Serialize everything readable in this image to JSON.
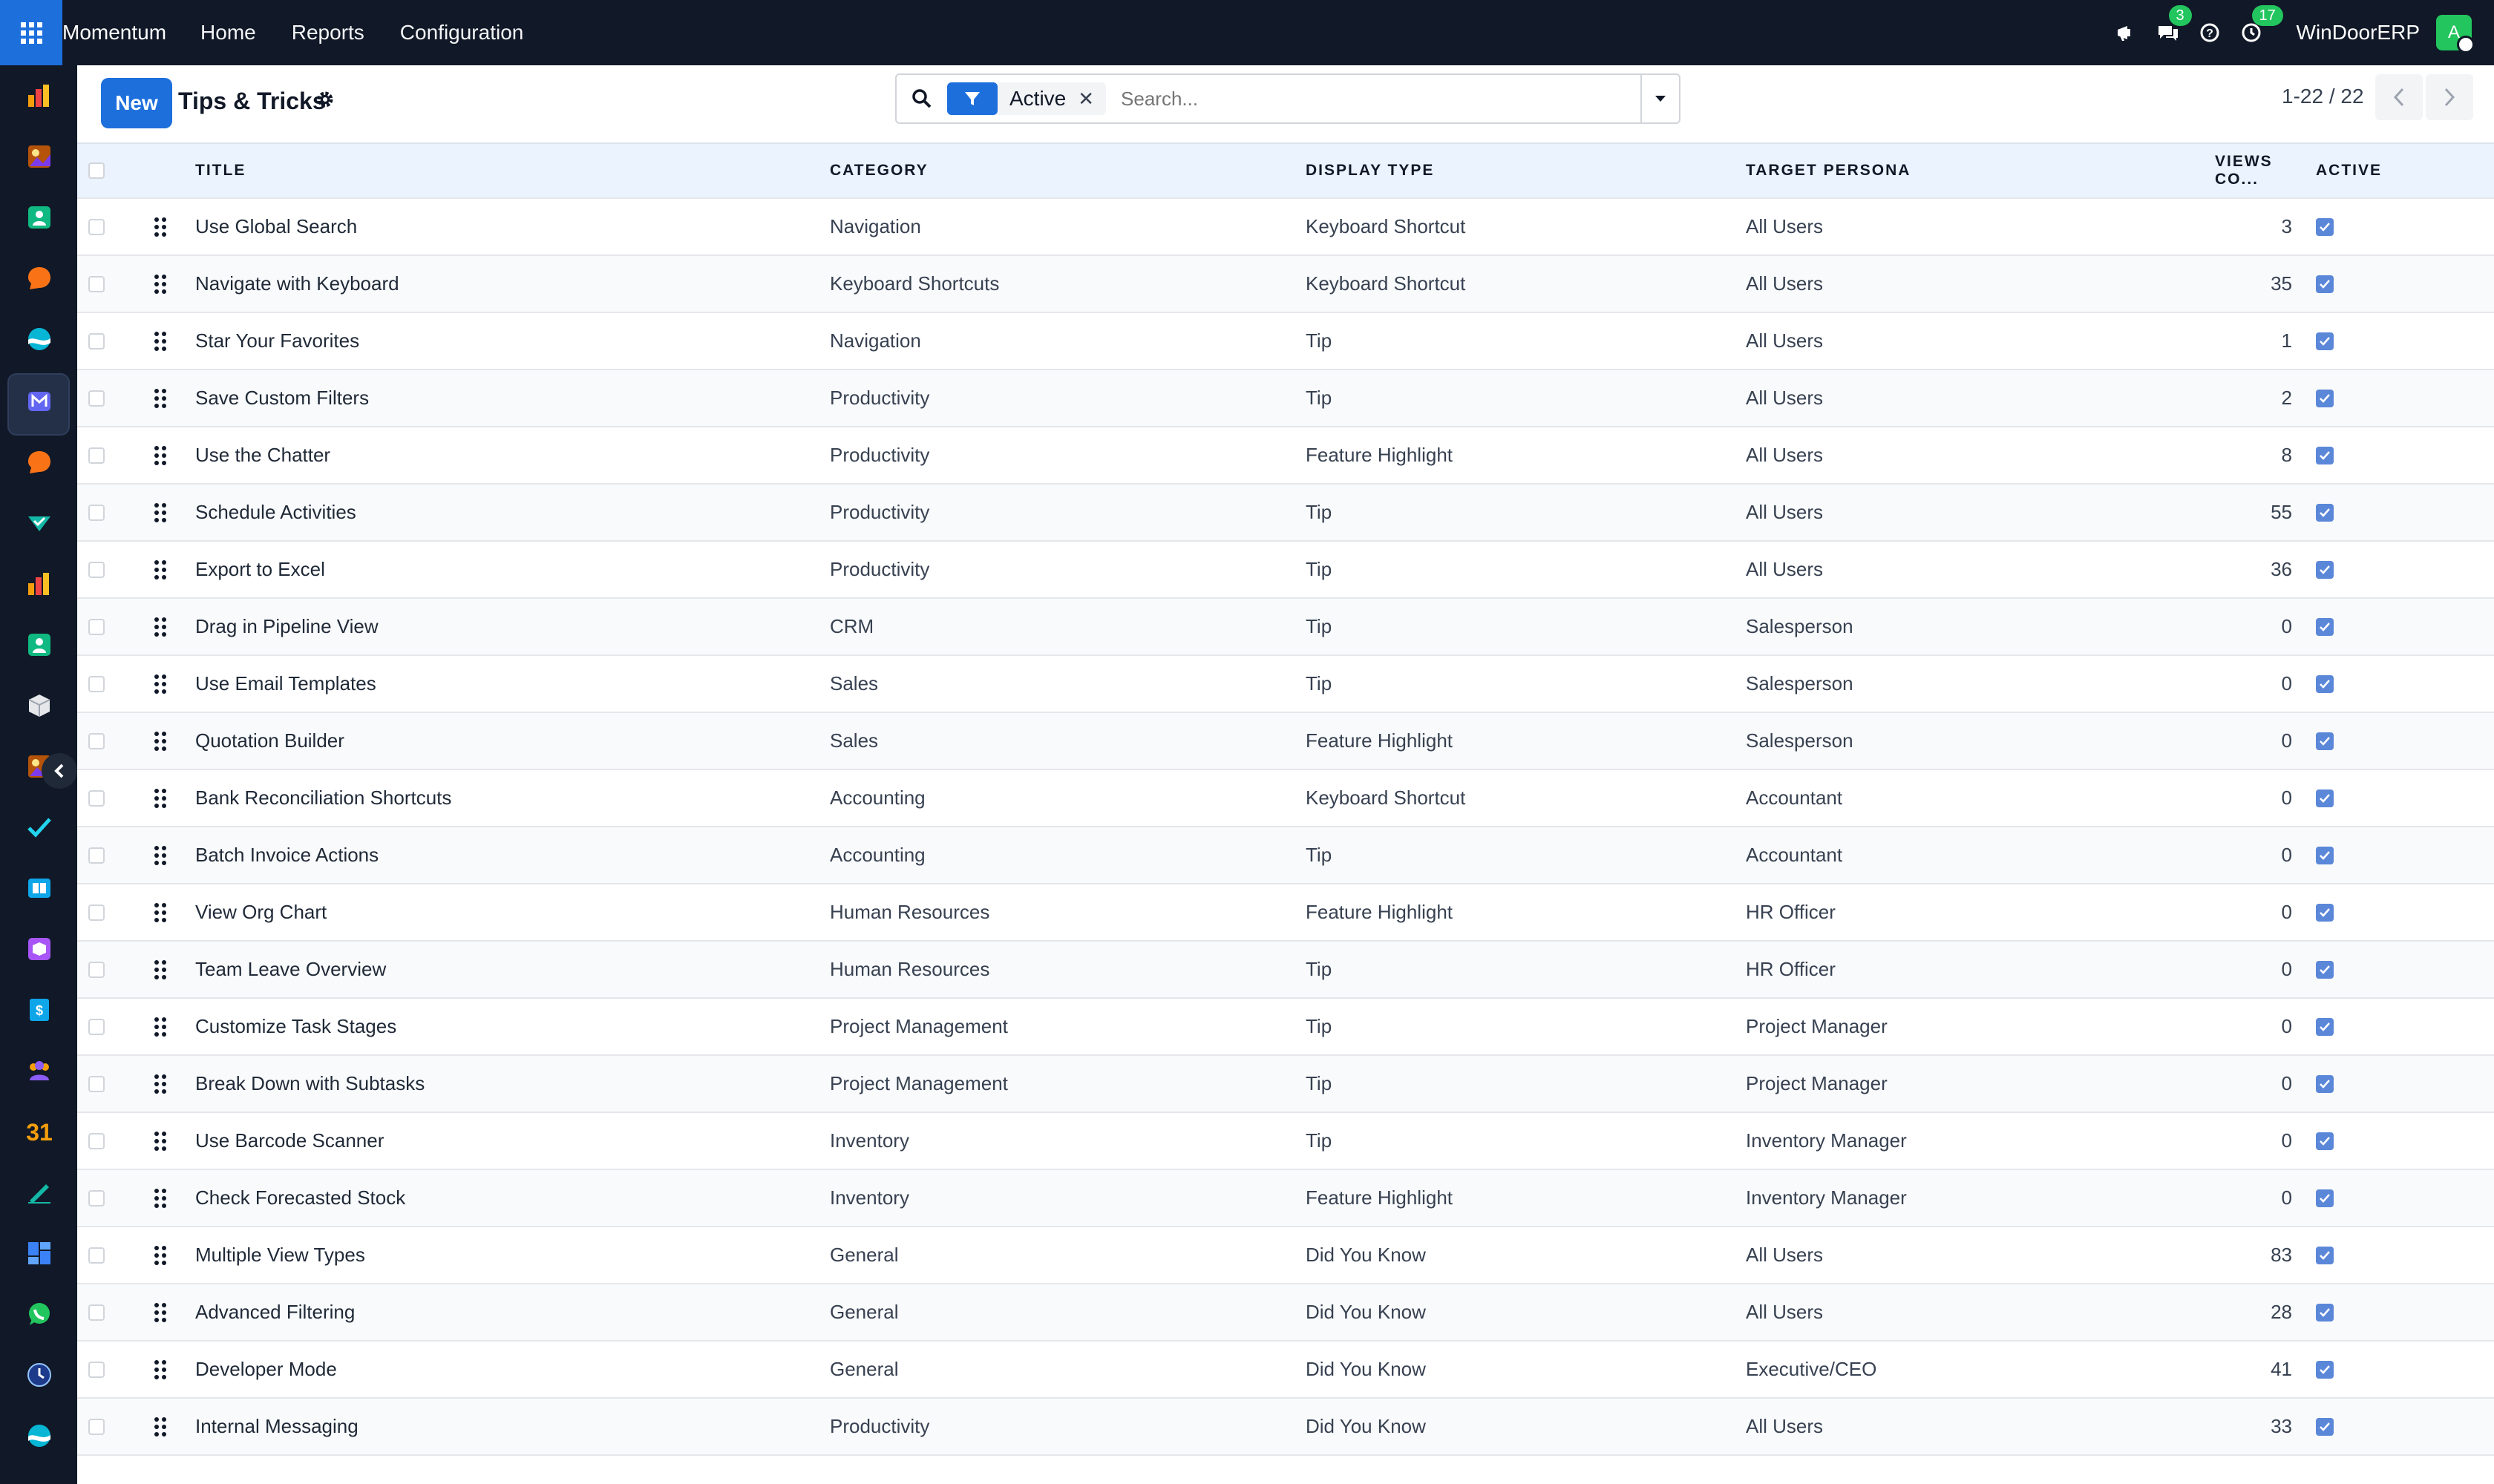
{
  "topbar": {
    "brand": "Momentum",
    "nav": [
      "Home",
      "Reports",
      "Configuration"
    ],
    "messages_badge": "3",
    "activities_badge": "17",
    "company": "WinDoorERP",
    "avatar_initial": "A"
  },
  "sidebar": {
    "icons": [
      "chart-app-icon",
      "photo-app-icon",
      "contacts-app-icon",
      "chat-bubble-app-icon",
      "wave-app-icon",
      "mail-app-icon",
      "chat-bubble-app-icon-2",
      "check-app-icon",
      "chart-app-icon-2",
      "contacts-app-icon-2",
      "cube-app-icon",
      "photo-app-icon-2",
      "tasks-check-app-icon",
      "book-app-icon",
      "box-app-icon",
      "dollar-app-icon",
      "team-app-icon",
      "calendar-app-icon",
      "sign-app-icon",
      "dashboard-app-icon",
      "whatsapp-app-icon",
      "clock-app-icon",
      "wave-app-icon-2"
    ],
    "calendar_number": "31",
    "dollar_symbol": "$"
  },
  "control": {
    "new_label": "New",
    "title": "Tips & Tricks",
    "filter_label": "Active",
    "search_placeholder": "Search...",
    "pager": "1-22 / 22"
  },
  "table": {
    "columns": {
      "title": "TITLE",
      "category": "CATEGORY",
      "display_type": "DISPLAY TYPE",
      "persona": "TARGET PERSONA",
      "views": "VIEWS CO...",
      "active": "ACTIVE"
    },
    "rows": [
      {
        "title": "Use Global Search",
        "category": "Navigation",
        "display_type": "Keyboard Shortcut",
        "persona": "All Users",
        "views": "3",
        "active": true
      },
      {
        "title": "Navigate with Keyboard",
        "category": "Keyboard Shortcuts",
        "display_type": "Keyboard Shortcut",
        "persona": "All Users",
        "views": "35",
        "active": true
      },
      {
        "title": "Star Your Favorites",
        "category": "Navigation",
        "display_type": "Tip",
        "persona": "All Users",
        "views": "1",
        "active": true
      },
      {
        "title": "Save Custom Filters",
        "category": "Productivity",
        "display_type": "Tip",
        "persona": "All Users",
        "views": "2",
        "active": true
      },
      {
        "title": "Use the Chatter",
        "category": "Productivity",
        "display_type": "Feature Highlight",
        "persona": "All Users",
        "views": "8",
        "active": true
      },
      {
        "title": "Schedule Activities",
        "category": "Productivity",
        "display_type": "Tip",
        "persona": "All Users",
        "views": "55",
        "active": true
      },
      {
        "title": "Export to Excel",
        "category": "Productivity",
        "display_type": "Tip",
        "persona": "All Users",
        "views": "36",
        "active": true
      },
      {
        "title": "Drag in Pipeline View",
        "category": "CRM",
        "display_type": "Tip",
        "persona": "Salesperson",
        "views": "0",
        "active": true
      },
      {
        "title": "Use Email Templates",
        "category": "Sales",
        "display_type": "Tip",
        "persona": "Salesperson",
        "views": "0",
        "active": true
      },
      {
        "title": "Quotation Builder",
        "category": "Sales",
        "display_type": "Feature Highlight",
        "persona": "Salesperson",
        "views": "0",
        "active": true
      },
      {
        "title": "Bank Reconciliation Shortcuts",
        "category": "Accounting",
        "display_type": "Keyboard Shortcut",
        "persona": "Accountant",
        "views": "0",
        "active": true
      },
      {
        "title": "Batch Invoice Actions",
        "category": "Accounting",
        "display_type": "Tip",
        "persona": "Accountant",
        "views": "0",
        "active": true
      },
      {
        "title": "View Org Chart",
        "category": "Human Resources",
        "display_type": "Feature Highlight",
        "persona": "HR Officer",
        "views": "0",
        "active": true
      },
      {
        "title": "Team Leave Overview",
        "category": "Human Resources",
        "display_type": "Tip",
        "persona": "HR Officer",
        "views": "0",
        "active": true
      },
      {
        "title": "Customize Task Stages",
        "category": "Project Management",
        "display_type": "Tip",
        "persona": "Project Manager",
        "views": "0",
        "active": true
      },
      {
        "title": "Break Down with Subtasks",
        "category": "Project Management",
        "display_type": "Tip",
        "persona": "Project Manager",
        "views": "0",
        "active": true
      },
      {
        "title": "Use Barcode Scanner",
        "category": "Inventory",
        "display_type": "Tip",
        "persona": "Inventory Manager",
        "views": "0",
        "active": true
      },
      {
        "title": "Check Forecasted Stock",
        "category": "Inventory",
        "display_type": "Feature Highlight",
        "persona": "Inventory Manager",
        "views": "0",
        "active": true
      },
      {
        "title": "Multiple View Types",
        "category": "General",
        "display_type": "Did You Know",
        "persona": "All Users",
        "views": "83",
        "active": true
      },
      {
        "title": "Advanced Filtering",
        "category": "General",
        "display_type": "Did You Know",
        "persona": "All Users",
        "views": "28",
        "active": true
      },
      {
        "title": "Developer Mode",
        "category": "General",
        "display_type": "Did You Know",
        "persona": "Executive/CEO",
        "views": "41",
        "active": true
      },
      {
        "title": "Internal Messaging",
        "category": "Productivity",
        "display_type": "Did You Know",
        "persona": "All Users",
        "views": "33",
        "active": true
      }
    ]
  }
}
